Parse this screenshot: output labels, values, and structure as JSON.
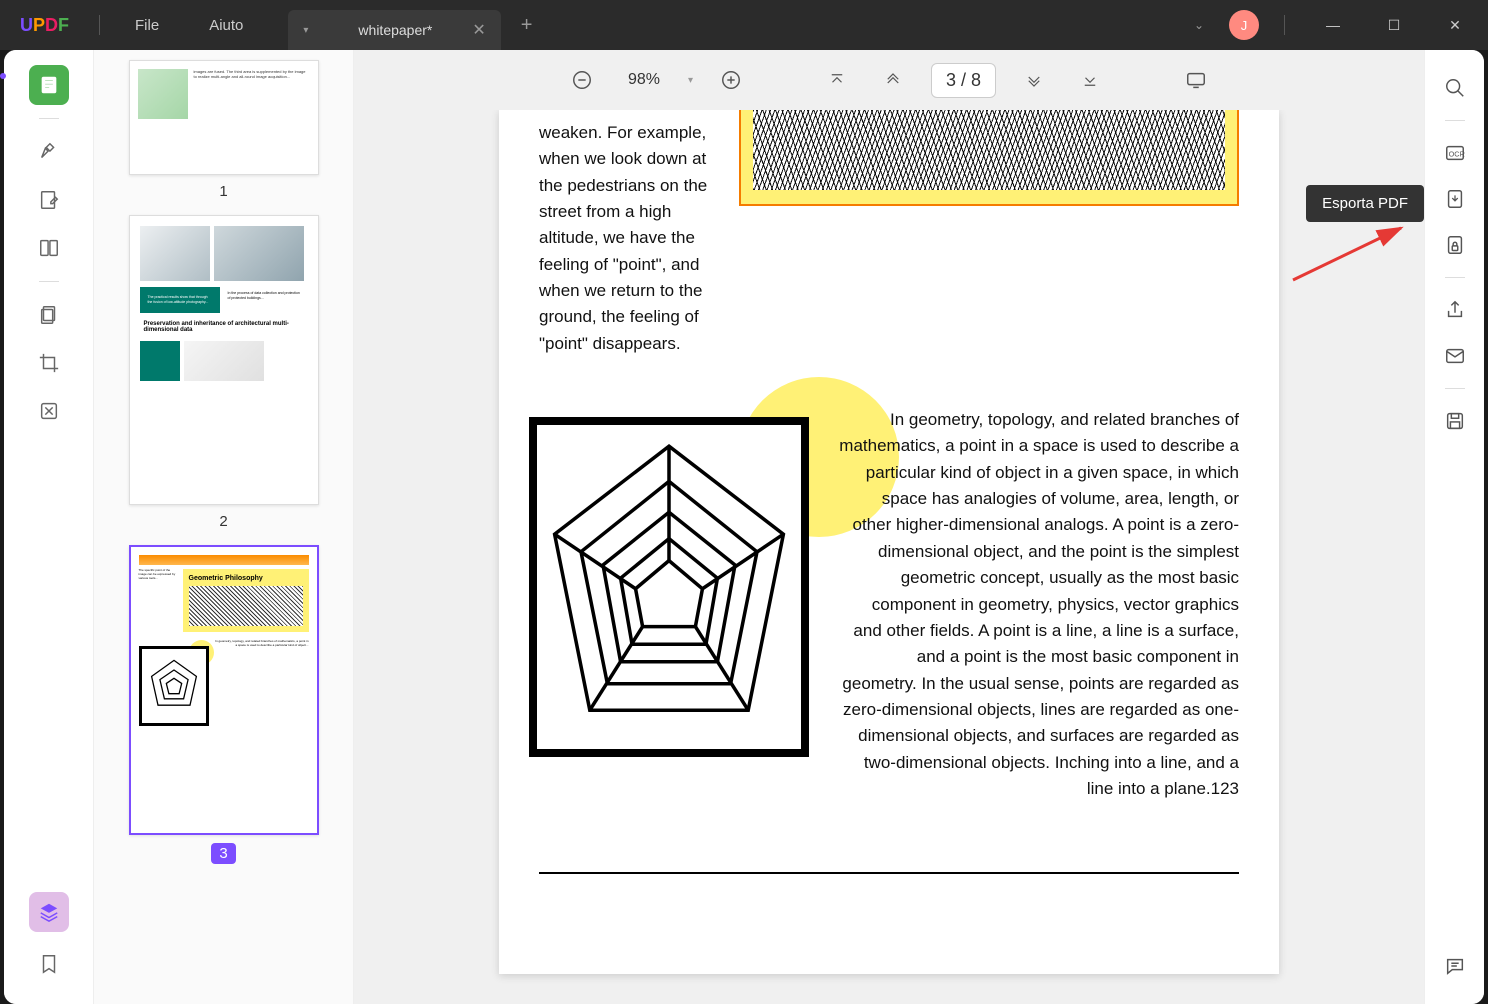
{
  "app": {
    "logo": "UPDF"
  },
  "menu": {
    "file": "File",
    "help": "Aiuto"
  },
  "tab": {
    "title": "whitepaper*"
  },
  "user": {
    "initial": "J"
  },
  "toolbar": {
    "zoom": "98%",
    "page_current": "3",
    "page_sep": " / ",
    "page_total": "8"
  },
  "thumbnails": [
    {
      "label": "1"
    },
    {
      "label": "2",
      "title": "Preservation and inheritance of architectural multi-dimensional data"
    },
    {
      "label": "3",
      "title": "Geometric Philosophy"
    }
  ],
  "tooltip": {
    "export_pdf": "Esporta PDF"
  },
  "document": {
    "left_para": "weaken. For example, when we look down at the pedestrians on the street from a high altitude, we have the feeling of \"point\", and when we return to the ground, the feeling of \"point\" disappears.",
    "right_para": "In geometry, topology, and related branches of mathematics, a point in a space is used to describe a particular kind of object in a given space, in which space has analogies of volume, area, length, or other higher-dimensional analogs. A point is a zero-dimensional object, and the point is the simplest geometric concept, usually as the most basic component in geometry, physics, vector graphics and other fields. A point is a line, a line is a surface, and a point is the most basic component in geometry. In the usual sense, points are regarded as zero-dimensional objects, lines are regarded as one-dimensional objects, and surfaces are regarded as two-dimensional objects. Inching into a line, and a line into a plane.123"
  }
}
